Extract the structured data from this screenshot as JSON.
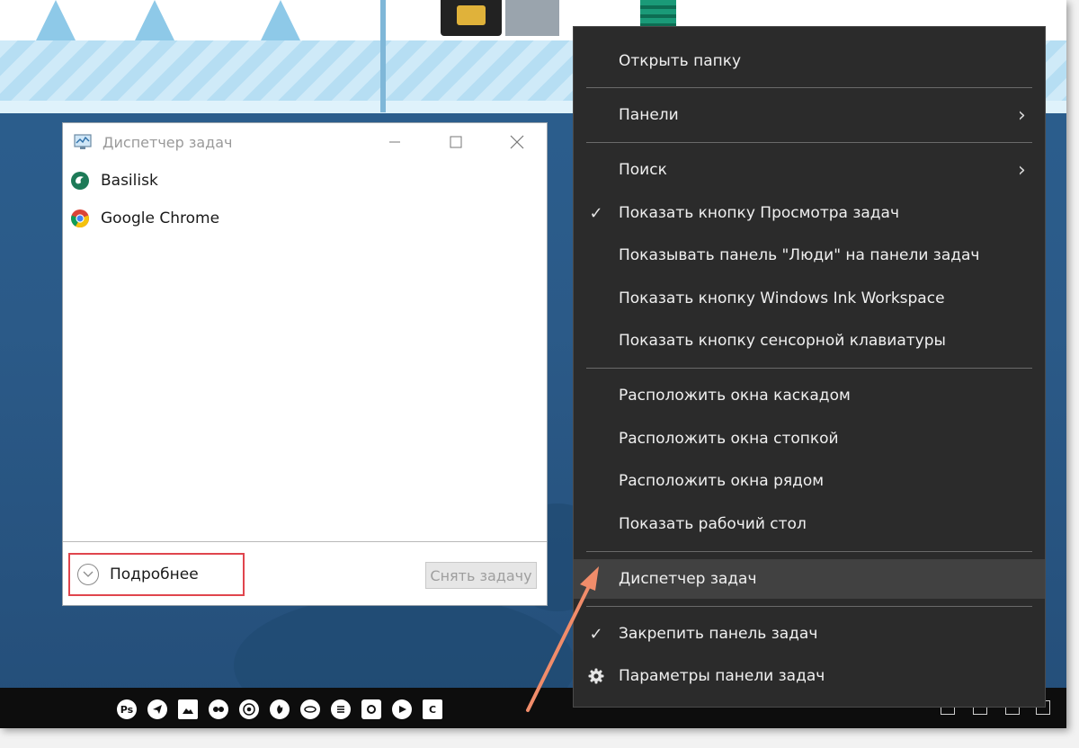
{
  "task_manager": {
    "title": "Диспетчер задач",
    "apps": [
      {
        "name": "Basilisk",
        "icon": "basilisk-icon"
      },
      {
        "name": "Google Chrome",
        "icon": "chrome-icon"
      }
    ],
    "details_label": "Подробнее",
    "end_task_label": "Снять задачу"
  },
  "context_menu": {
    "items": [
      {
        "label": "Открыть папку",
        "checked": false,
        "submenu": false
      },
      {
        "label": "Панели",
        "checked": false,
        "submenu": true
      },
      {
        "label": "Поиск",
        "checked": false,
        "submenu": true
      },
      {
        "label": "Показать кнопку Просмотра задач",
        "checked": true,
        "submenu": false
      },
      {
        "label": "Показывать панель \"Люди\" на панели задач",
        "checked": false,
        "submenu": false
      },
      {
        "label": "Показать кнопку Windows Ink Workspace",
        "checked": false,
        "submenu": false
      },
      {
        "label": "Показать кнопку сенсорной клавиатуры",
        "checked": false,
        "submenu": false
      },
      {
        "label": "Расположить окна каскадом",
        "checked": false,
        "submenu": false
      },
      {
        "label": "Расположить окна стопкой",
        "checked": false,
        "submenu": false
      },
      {
        "label": "Расположить окна рядом",
        "checked": false,
        "submenu": false
      },
      {
        "label": "Показать рабочий стол",
        "checked": false,
        "submenu": false
      },
      {
        "label": "Диспетчер задач",
        "checked": false,
        "submenu": false,
        "highlighted": true
      },
      {
        "label": "Закрепить панель задач",
        "checked": true,
        "submenu": false
      },
      {
        "label": "Параметры панели задач",
        "checked": false,
        "submenu": false,
        "icon": "gear-icon"
      }
    ],
    "check_glyph": "✓",
    "arrow_glyph": "›"
  },
  "taskbar": {
    "icons": [
      "photoshop-icon",
      "telegram-icon",
      "photos-icon",
      "webcam-icon",
      "chrome-icon",
      "firefox-icon",
      "basilisk-icon",
      "layers-icon",
      "settings-icon",
      "player-icon",
      "c-app-icon"
    ],
    "ps_label": "Ps",
    "c_label": "C"
  },
  "colors": {
    "highlight_box": "#e0454d",
    "arrow": "#f08c6a",
    "menu_bg": "#2b2b2b"
  }
}
